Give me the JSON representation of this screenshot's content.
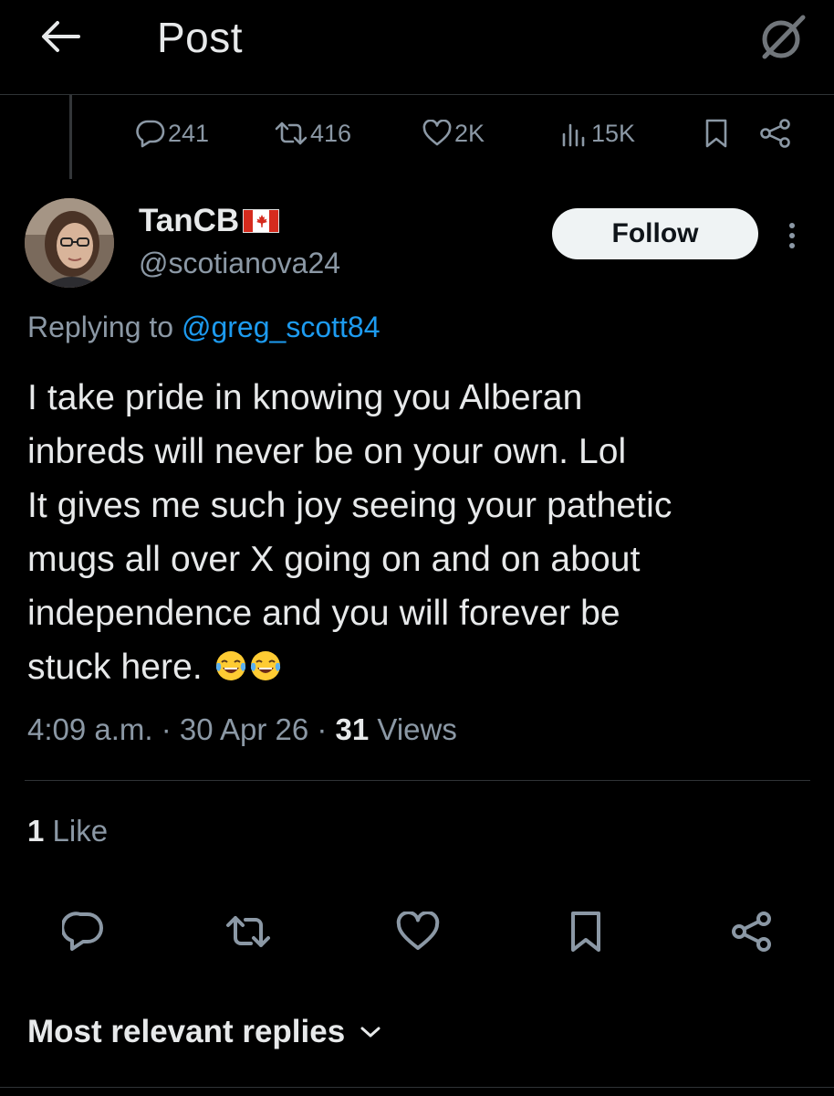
{
  "header": {
    "title": "Post",
    "back_icon": "arrow-left-icon",
    "grok_icon": "grok-slash-circle-icon"
  },
  "parent_post": {
    "replies": "241",
    "reposts": "416",
    "likes": "2K",
    "views": "15K"
  },
  "author": {
    "display_name": "TanCB",
    "flag_icon": "canada-flag-icon",
    "handle": "@scotianova24",
    "follow_label": "Follow"
  },
  "reply_to": {
    "prefix": "Replying to ",
    "mention": "@greg_scott84"
  },
  "tweet": {
    "text": "I take pride in knowing you Alberan\ninbreds will never be on your own. Lol\nIt gives me such joy seeing your pathetic\nmugs all over X going on and on about\nindependence and you will forever be\nstuck here. ",
    "emoji": "face-with-tears-of-joy"
  },
  "meta": {
    "time": "4:09 a.m.",
    "date": "30 Apr 26",
    "separator": " · ",
    "views_count": "31",
    "views_label": " Views"
  },
  "engagement": {
    "likes_count": "1",
    "likes_label": " Like"
  },
  "sort": {
    "label": "Most relevant replies"
  },
  "colors": {
    "background": "#000000",
    "text": "#e7e9ea",
    "secondary": "#8b98a5",
    "accent": "#1d9bf0",
    "border": "#2f3336"
  }
}
